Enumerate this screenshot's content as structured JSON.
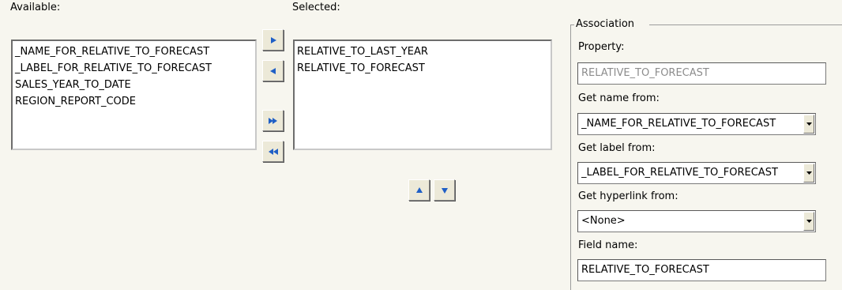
{
  "available": {
    "label": "Available:",
    "items": [
      "_NAME_FOR_RELATIVE_TO_FORECAST",
      "_LABEL_FOR_RELATIVE_TO_FORECAST",
      "SALES_YEAR_TO_DATE",
      "REGION_REPORT_CODE"
    ]
  },
  "selected": {
    "label": "Selected:",
    "items": [
      "RELATIVE_TO_LAST_YEAR",
      "RELATIVE_TO_FORECAST"
    ]
  },
  "transfer_buttons": {
    "add": "arrow-right-icon",
    "remove": "arrow-left-icon",
    "add_all": "double-arrow-right-icon",
    "remove_all": "double-arrow-left-icon",
    "move_up": "arrow-up-icon",
    "move_down": "arrow-down-icon"
  },
  "association": {
    "title": "Association",
    "property_label": "Property:",
    "property_value": "RELATIVE_TO_FORECAST",
    "name_from_label": "Get name from:",
    "name_from_value": "_NAME_FOR_RELATIVE_TO_FORECAST",
    "label_from_label": "Get label from:",
    "label_from_value": "_LABEL_FOR_RELATIVE_TO_FORECAST",
    "hyperlink_from_label": "Get hyperlink from:",
    "hyperlink_from_value": "<None>",
    "field_name_label": "Field name:",
    "field_name_value": "RELATIVE_TO_FORECAST"
  },
  "colors": {
    "background": "#f7f6ef",
    "arrow_blue": "#1f5fc6",
    "button_face": "#ece9d8"
  }
}
